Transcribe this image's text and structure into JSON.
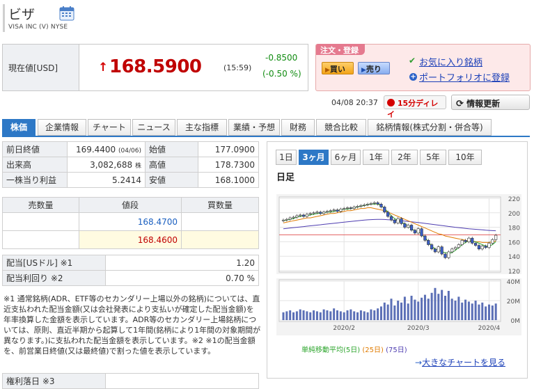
{
  "header": {
    "title": "ビザ",
    "subtitle": "VISA INC  (V)  NYSE"
  },
  "price": {
    "label": "現在値[USD]",
    "arrow": "↑",
    "value": "168.5900",
    "time": "(15:59)",
    "change": "-0.8500",
    "change_pct": "(-0.50 %)"
  },
  "order": {
    "tab": "注文・登録",
    "buy": "買い",
    "sell": "売り",
    "favorite": "お気に入り銘柄",
    "portfolio": "ポートフォリオに登録"
  },
  "status": {
    "timestamp": "04/08 20:37",
    "delay": "15分ディレイ",
    "refresh": "情報更新"
  },
  "tabs": [
    "株価",
    "企業情報",
    "チャート",
    "ニュース",
    "主な指標",
    "業績・予想",
    "財務",
    "競合比較",
    "銘柄情報(株式分割・併合等)"
  ],
  "stats": {
    "prev_close_label": "前日終値",
    "prev_close": "169.4400",
    "prev_close_date": "(04/06)",
    "open_label": "始値",
    "open": "177.0900",
    "volume_label": "出来高",
    "volume": "3,082,688",
    "volume_unit": "株",
    "high_label": "高値",
    "high": "178.7300",
    "eps_label": "一株当り利益",
    "eps": "5.2414",
    "low_label": "安値",
    "low": "168.1000"
  },
  "board": {
    "sell_qty": "売数量",
    "price": "値段",
    "buy_qty": "買数量",
    "ask": "168.4700",
    "bid": "168.4600"
  },
  "dividend": {
    "label1": "配当[USドル] ※1",
    "value1": "1.20",
    "label2": "配当利回り ※2",
    "value2": "0.70 %"
  },
  "note": "※1 通常銘柄(ADR、ETF等のセカンダリー上場以外の銘柄)については、直近支払われた配当金額(又は会社発表により支払いが確定した配当金額)を年率換算した金額を表示しています。ADR等のセカンダリー上場銘柄については、原則、直近半期から起算して1年間(銘柄により1年間の対象期間が異なります。)に支払われた配当金額を表示しています。※2 ※1の配当金額を、前営業日終値(又は最終値)で割った値を表示しています。",
  "note_tail": "権利落日 ※3",
  "chart": {
    "periods": [
      "1日",
      "3ヶ月",
      "6ヶ月",
      "1年",
      "2年",
      "5年",
      "10年"
    ],
    "active_period": "3ヶ月",
    "title": "日足",
    "legend_prefix": "単純移動平均",
    "legend_5": "(5日)",
    "legend_25": "(25日)",
    "legend_75": "(75日)",
    "link": "大きなチャートを見る"
  },
  "chart_data": {
    "type": "candlestick",
    "price_axis": {
      "ticks": [
        "220",
        "200",
        "180",
        "160",
        "140",
        "120"
      ],
      "ylim": [
        120,
        220
      ]
    },
    "volume_axis": {
      "ticks": [
        "40M",
        "20M",
        "0M"
      ],
      "ylim": [
        0,
        40
      ]
    },
    "x_ticks": [
      "2020/2",
      "2020/3",
      "2020/4"
    ],
    "closes": [
      190,
      191,
      193,
      194,
      196,
      197,
      195,
      198,
      199,
      200,
      201,
      199,
      201,
      202,
      203,
      204,
      202,
      205,
      206,
      207,
      206,
      208,
      209,
      210,
      211,
      212,
      213,
      214,
      212,
      208,
      201,
      195,
      190,
      186,
      192,
      185,
      180,
      183,
      176,
      172,
      178,
      168,
      162,
      156,
      150,
      146,
      153,
      143,
      138,
      146,
      150,
      152,
      156,
      162,
      160,
      165,
      158,
      155,
      150,
      154,
      152,
      158,
      163,
      169
    ],
    "volumes": [
      8,
      9,
      10,
      8,
      9,
      11,
      10,
      9,
      8,
      10,
      9,
      8,
      11,
      10,
      9,
      12,
      10,
      9,
      8,
      10,
      11,
      9,
      8,
      10,
      9,
      8,
      11,
      10,
      12,
      14,
      18,
      16,
      22,
      15,
      20,
      18,
      24,
      17,
      25,
      21,
      19,
      23,
      26,
      22,
      28,
      33,
      27,
      31,
      25,
      30,
      22,
      20,
      24,
      18,
      21,
      19,
      17,
      20,
      16,
      18,
      14,
      16,
      15,
      17
    ],
    "ma5": [
      189,
      190,
      191,
      192,
      194,
      195,
      196,
      196,
      197,
      198,
      199,
      199,
      200,
      201,
      201,
      202,
      203,
      204,
      205,
      205,
      206,
      207,
      208,
      209,
      210,
      211,
      212,
      212,
      212,
      210,
      206,
      201,
      196,
      192,
      189,
      187,
      185,
      182,
      178,
      175,
      174,
      170,
      166,
      160,
      154,
      150,
      149,
      146,
      145,
      144,
      145,
      148,
      152,
      156,
      159,
      161,
      160,
      160,
      158,
      156,
      154,
      154,
      156,
      160
    ],
    "ma25": [
      186,
      187,
      188,
      189,
      190,
      191,
      192,
      193,
      193,
      194,
      195,
      196,
      197,
      198,
      199,
      199,
      200,
      201,
      202,
      203,
      203,
      204,
      205,
      206,
      206,
      207,
      207,
      206,
      205,
      204,
      203,
      201,
      199,
      197,
      195,
      193,
      191,
      189,
      187,
      185,
      183,
      181,
      179,
      177,
      175,
      173,
      171,
      170,
      168,
      167,
      166,
      165,
      164,
      163,
      162,
      161,
      161,
      160,
      160,
      159,
      159,
      159,
      160,
      161
    ],
    "ma75": [
      178,
      178.5,
      179,
      179.5,
      180,
      180.5,
      181,
      181.5,
      182,
      182.5,
      183,
      183.5,
      184,
      184.5,
      185,
      185.5,
      186,
      186.5,
      187,
      187.5,
      188,
      188.5,
      189,
      189.5,
      190,
      190.3,
      190.6,
      190.8,
      191,
      191,
      190.8,
      190.5,
      190.2,
      189.8,
      189.4,
      189,
      188.6,
      188.1,
      187.6,
      187.1,
      186.6,
      186,
      185.4,
      184.8,
      184.2,
      183.6,
      183,
      182.4,
      181.8,
      181.2,
      180.6,
      180,
      179.5,
      179,
      178.5,
      178,
      177.6,
      177.2,
      176.8,
      176.4,
      176,
      175.7,
      175.4,
      175.2
    ],
    "colors": {
      "ma5": "#2fa62f",
      "ma25": "#e07b00",
      "ma75": "#4d3cb0",
      "candle_up": "#ffffff",
      "candle_down": "#3a5ec8",
      "volume": "#5b6fb6",
      "prev_close_line": "#e05050"
    }
  }
}
